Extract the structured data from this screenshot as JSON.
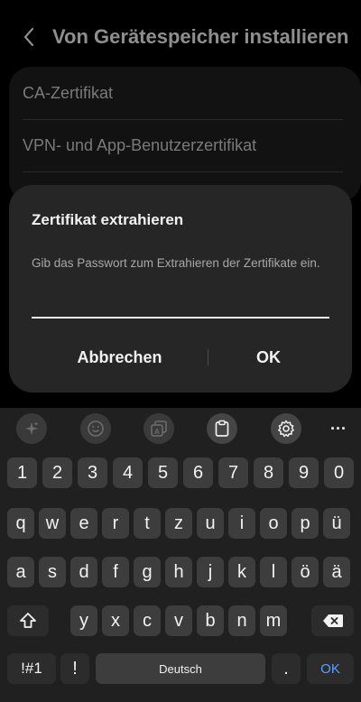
{
  "header": {
    "title": "Von Gerätespeicher installieren",
    "back_icon": "chevron-left-icon"
  },
  "list": {
    "items": [
      {
        "label": "CA-Zertifikat"
      },
      {
        "label": "VPN- und App-Benutzerzertifikat"
      }
    ]
  },
  "dialog": {
    "title": "Zertifikat extrahieren",
    "message": "Gib das Passwort zum Extrahieren der Zertifikate ein.",
    "password_value": "",
    "cancel_label": "Abbrechen",
    "ok_label": "OK"
  },
  "keyboard": {
    "toolbar_icons": [
      "sparkle-icon",
      "emoji-icon",
      "sticker-icon",
      "clipboard-icon",
      "settings-gear-icon",
      "more-dots-icon"
    ],
    "more_label": "···",
    "row_numbers": [
      "1",
      "2",
      "3",
      "4",
      "5",
      "6",
      "7",
      "8",
      "9",
      "0"
    ],
    "row_1": [
      "q",
      "w",
      "e",
      "r",
      "t",
      "z",
      "u",
      "i",
      "o",
      "p",
      "ü"
    ],
    "row_2": [
      "a",
      "s",
      "d",
      "f",
      "g",
      "h",
      "j",
      "k",
      "l",
      "ö",
      "ä"
    ],
    "row_3": [
      "y",
      "x",
      "c",
      "v",
      "b",
      "n",
      "m"
    ],
    "symbols_label": "!#1",
    "exclaim_label": "!",
    "space_label": "Deutsch",
    "period_label": ".",
    "enter_label": "OK",
    "accent_color": "#5aa0ff"
  }
}
